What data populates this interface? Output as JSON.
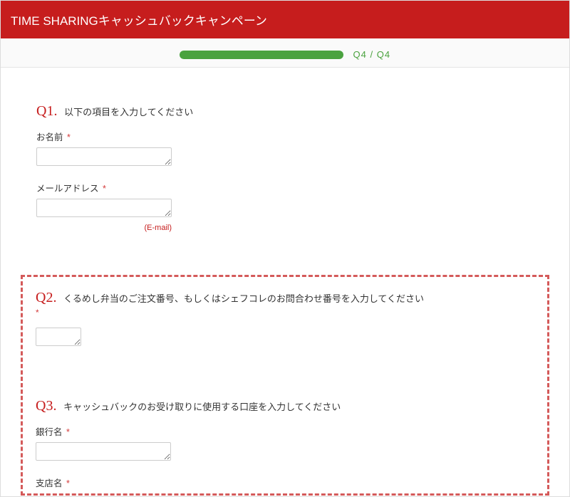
{
  "header": {
    "title": "TIME SHARINGキャッシュバックキャンペーン"
  },
  "progress": {
    "current": "Q4",
    "total": "Q4",
    "separator": " / "
  },
  "questions": {
    "q1": {
      "num": "Q1.",
      "text": "以下の項目を入力してください",
      "fields": {
        "name": {
          "label": "お名前",
          "required": "*"
        },
        "email": {
          "label": "メールアドレス",
          "required": "*",
          "hint": "(E-mail)"
        }
      }
    },
    "q2": {
      "num": "Q2.",
      "text": "くるめし弁当のご注文番号、もしくはシェフコレのお問合わせ番号を入力してください",
      "required": "*"
    },
    "q3": {
      "num": "Q3.",
      "text": "キャッシュバックのお受け取りに使用する口座を入力してください",
      "fields": {
        "bank": {
          "label": "銀行名",
          "required": "*"
        },
        "branch": {
          "label": "支店名",
          "required": "*"
        }
      }
    }
  }
}
